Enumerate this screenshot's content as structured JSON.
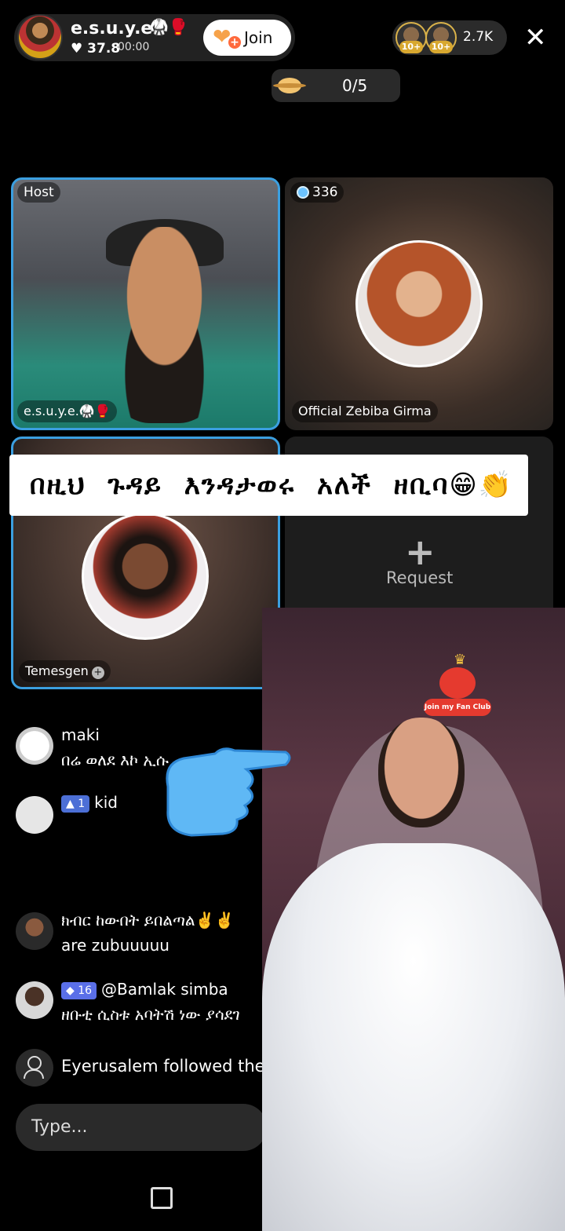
{
  "header": {
    "host_name": "e.s.u.y.e.",
    "host_icons": "🥋🥊",
    "host_likes": "♥ 37.8",
    "timer": "00:00",
    "join_label": "Join",
    "viewer_count": "2.7K",
    "viewer_badges": [
      "10+",
      "10+"
    ],
    "close_label": "✕"
  },
  "goal": {
    "progress_text": "0/5"
  },
  "grid": {
    "host_tag": "Host",
    "host_name": "e.s.u.y.e.🥋🥊",
    "zebiba_score": "336",
    "zebiba_name": "Official Zebiba Girma",
    "temesgen_name": "Temesgen",
    "request_label": "Request"
  },
  "caption": "በዚህ ጉዳይ እንዳታወሩ አለች ዘቢባ😁👏",
  "comments": [
    {
      "user": "maki",
      "text": "በሬ ወለደ እኮ ኢሱ"
    },
    {
      "level": "1",
      "user": "kid"
    },
    {
      "text_line1": "ክብር ከውበት ይበልጣል✌️✌️",
      "text_line2": "are zubuuuuu"
    },
    {
      "level": "16",
      "user": "@Bamlak simba",
      "text": "ዘቡቲ ሲስቱ አባትሽ ነው ያሳደገ"
    }
  ],
  "follow_event": "Eyerusalem followed the host",
  "input": {
    "placeholder": "Type..."
  },
  "fanclub_label": "Join my Fan Club",
  "colors": {
    "accent_blue": "#3b9fe0",
    "join_orange": "#f6a24a",
    "fanclub_red": "#e53a2f"
  }
}
